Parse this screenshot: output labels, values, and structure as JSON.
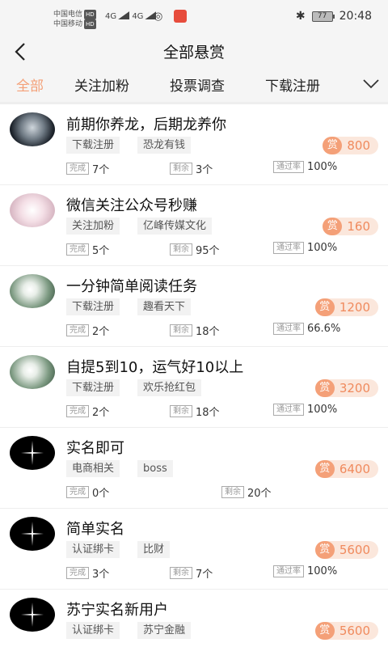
{
  "status": {
    "carrier1": "中国电信",
    "carrier2": "中国移动",
    "hd": "HD",
    "net1": "4G",
    "net2": "4G",
    "battery": "77",
    "time": "20:48"
  },
  "header": {
    "title": "全部悬赏"
  },
  "tabs": [
    "全部",
    "关注加粉",
    "投票调查",
    "下载注册"
  ],
  "active_tab": "全部",
  "labels": {
    "done": "完成",
    "remain": "剩余",
    "rate": "通过率",
    "reward_seal": "赏"
  },
  "tasks": [
    {
      "title": "前期你养龙，后期龙养你",
      "tags": [
        "下载注册",
        "恐龙有钱"
      ],
      "reward": "800",
      "done": "7个",
      "remain": "3个",
      "rate": "100%"
    },
    {
      "title": "微信关注公众号秒赚",
      "tags": [
        "关注加粉",
        "亿峰传媒文化"
      ],
      "reward": "160",
      "done": "5个",
      "remain": "95个",
      "rate": "100%"
    },
    {
      "title": "一分钟简单阅读任务",
      "tags": [
        "下载注册",
        "趣看天下"
      ],
      "reward": "1200",
      "done": "2个",
      "remain": "18个",
      "rate": "66.6%"
    },
    {
      "title": "自提5到10，运气好10以上",
      "tags": [
        "下载注册",
        "欢乐抢红包"
      ],
      "reward": "3200",
      "done": "2个",
      "remain": "18个",
      "rate": "100%"
    },
    {
      "title": "实名即可",
      "tags": [
        "电商相关",
        "boss"
      ],
      "reward": "6400",
      "done": "0个",
      "remain": "20个",
      "rate": ""
    },
    {
      "title": "简单实名",
      "tags": [
        "认证绑卡",
        "比财"
      ],
      "reward": "5600",
      "done": "3个",
      "remain": "7个",
      "rate": "100%"
    },
    {
      "title": "苏宁实名新用户",
      "tags": [
        "认证绑卡",
        "苏宁金融"
      ],
      "reward": "5600",
      "done": "",
      "remain": "",
      "rate": ""
    }
  ],
  "colors": {
    "accent": "#f4a078",
    "reward_bg": "#fbe7dc",
    "reward_text": "#f08a5d"
  }
}
